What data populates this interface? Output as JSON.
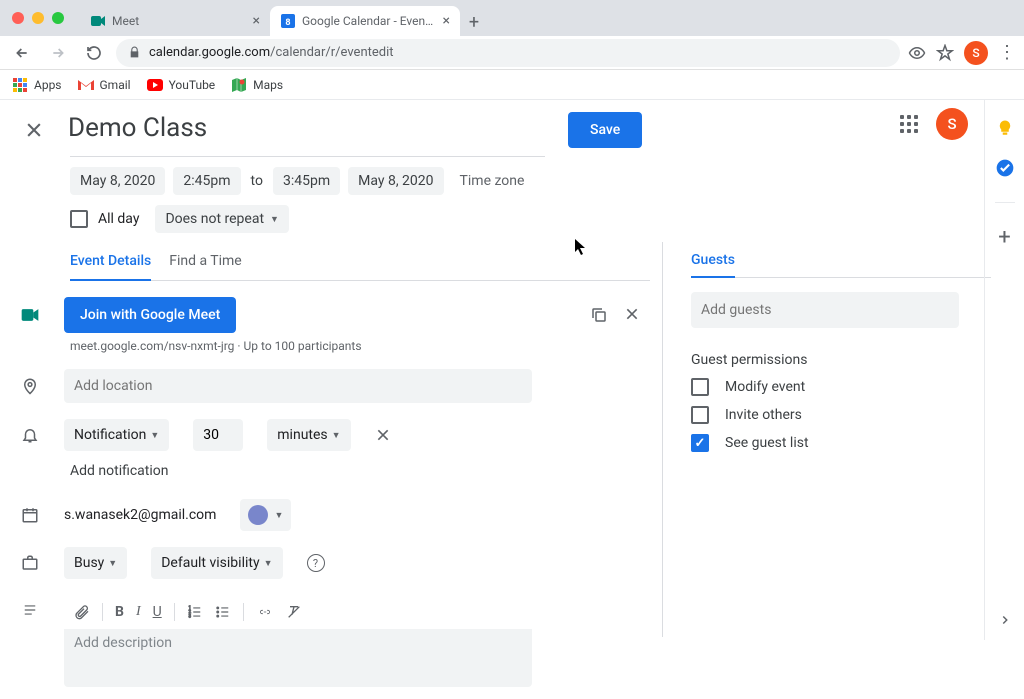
{
  "browser": {
    "tabs": [
      {
        "title": "Meet",
        "active": false
      },
      {
        "title": "Google Calendar - Event detai",
        "active": true
      }
    ],
    "url_prefix": "calendar.google.com",
    "url_rest": "/calendar/r/eventedit",
    "bookmarks": [
      "Apps",
      "Gmail",
      "YouTube",
      "Maps"
    ],
    "avatar_letter": "S"
  },
  "event": {
    "title": "Demo Class",
    "save_label": "Save",
    "start_date": "May 8, 2020",
    "start_time": "2:45pm",
    "to_label": "to",
    "end_time": "3:45pm",
    "end_date": "May 8, 2020",
    "timezone_link": "Time zone",
    "allday_label": "All day",
    "repeat_label": "Does not repeat",
    "tabs": {
      "details": "Event Details",
      "find_time": "Find a Time"
    },
    "meet": {
      "button": "Join with Google Meet",
      "link": "meet.google.com/nsv-nxmt-jrg",
      "separator": " · ",
      "limit": "Up to 100 participants"
    },
    "location_placeholder": "Add location",
    "notification": {
      "type": "Notification",
      "amount": "30",
      "unit": "minutes",
      "add_label": "Add notification"
    },
    "calendar": {
      "email": "s.wanasek2@gmail.com"
    },
    "availability": "Busy",
    "visibility": "Default visibility",
    "description_placeholder": "Add description"
  },
  "guests": {
    "tab_label": "Guests",
    "input_placeholder": "Add guests",
    "permissions_title": "Guest permissions",
    "perm_modify": "Modify event",
    "perm_invite": "Invite others",
    "perm_see": "See guest list"
  }
}
